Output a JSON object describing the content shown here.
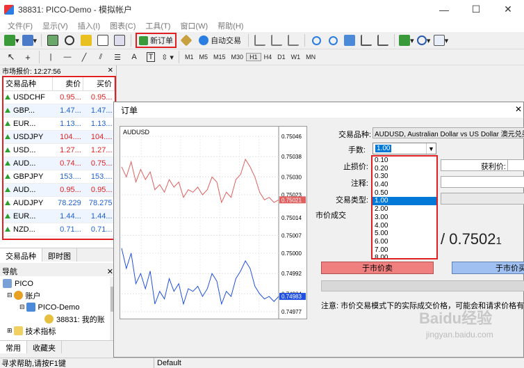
{
  "window": {
    "title": "38831: PICO-Demo - 模拟帐户",
    "controls": [
      "—",
      "☐",
      "✕"
    ]
  },
  "menu": [
    "文件(F)",
    "显示(V)",
    "插入(I)",
    "图表(C)",
    "工具(T)",
    "窗口(W)",
    "帮助(H)"
  ],
  "toolbar": {
    "new_order_label": "新订单",
    "auto_trade_label": "自动交易"
  },
  "timeframes": [
    "M1",
    "M5",
    "M15",
    "M30",
    "H1",
    "H4",
    "D1",
    "W1",
    "MN"
  ],
  "timeframe_active": "H1",
  "market_watch": {
    "header": "市场报价: 12:27:56",
    "col_symbol": "交易品种",
    "col_bid": "卖价",
    "col_ask": "买价",
    "rows": [
      {
        "symbol": "USDCHF",
        "bid": "0.95...",
        "ask": "0.95...",
        "dir": "up",
        "color": "red"
      },
      {
        "symbol": "GBP...",
        "bid": "1.47...",
        "ask": "1.47...",
        "dir": "up",
        "color": "blue"
      },
      {
        "symbol": "EUR...",
        "bid": "1.13...",
        "ask": "1.13...",
        "dir": "up",
        "color": "blue"
      },
      {
        "symbol": "USDJPY",
        "bid": "104....",
        "ask": "104....",
        "dir": "up",
        "color": "red"
      },
      {
        "symbol": "USD...",
        "bid": "1.27...",
        "ask": "1.27...",
        "dir": "up",
        "color": "red"
      },
      {
        "symbol": "AUD...",
        "bid": "0.74...",
        "ask": "0.75...",
        "dir": "up",
        "color": "red"
      },
      {
        "symbol": "GBPJPY",
        "bid": "153....",
        "ask": "153....",
        "dir": "up",
        "color": "blue"
      },
      {
        "symbol": "AUD...",
        "bid": "0.95...",
        "ask": "0.95...",
        "dir": "up",
        "color": "red"
      },
      {
        "symbol": "AUDJPY",
        "bid": "78.229",
        "ask": "78.275",
        "dir": "up",
        "color": "blue"
      },
      {
        "symbol": "EUR...",
        "bid": "1.44...",
        "ask": "1.44...",
        "dir": "up",
        "color": "blue"
      },
      {
        "symbol": "NZD...",
        "bid": "0.71...",
        "ask": "0.71...",
        "dir": "up",
        "color": "blue"
      }
    ],
    "tabs": [
      "交易品种",
      "即时图"
    ]
  },
  "navigator": {
    "header": "导航",
    "items": [
      "PICO",
      "账户",
      "PICO-Demo",
      "38831: 我的账",
      "技术指标"
    ],
    "tabs": [
      "常用",
      "收藏夹"
    ]
  },
  "status": {
    "help": "寻求帮助,请按F1键",
    "profile": "Default"
  },
  "order_dialog": {
    "title": "订单",
    "chart_symbol": "AUDUSD",
    "price_ticks": [
      "0.75046",
      "0.75038",
      "0.75030",
      "0.75023",
      "0.75014",
      "0.75007",
      "0.75000",
      "0.74992",
      "0.74984",
      "0.74983",
      "0.74977"
    ],
    "price_tag_ask": "0.75021",
    "price_tag_bid": "0.74983",
    "symbol_label": "交易品种:",
    "symbol_value": "AUDUSD, Australian Dollar vs US Dollar 澳元兑美元",
    "lots_label": "手数:",
    "lots_value": "1.00",
    "lots_options": [
      "0.10",
      "0.20",
      "0.30",
      "0.40",
      "0.50",
      "1.00",
      "2.00",
      "3.00",
      "4.00",
      "5.00",
      "6.00",
      "7.00",
      "8.00"
    ],
    "sl_label": "止损价:",
    "tp_label": "获利价:",
    "comment_label": "注释:",
    "type_label": "交易类型:",
    "market_exec": "市价成交",
    "price_display": "/ 0.7502",
    "price_small": "1",
    "sell_button": "于市价卖",
    "buy_button": "于市价买",
    "note": "注意: 市价交易模式下的实际成交价格，可能会和请求价格有"
  },
  "chart_data": {
    "type": "line",
    "title": "AUDUSD",
    "ylim": [
      0.74977,
      0.75046
    ],
    "series": [
      {
        "name": "Ask",
        "color": "#e06060",
        "values": [
          0.75034,
          0.7503,
          0.75036,
          0.75028,
          0.75033,
          0.75029,
          0.75032,
          0.75025,
          0.75027,
          0.75024,
          0.75029,
          0.75026,
          0.75028,
          0.75022,
          0.75025,
          0.75024,
          0.75026,
          0.75023,
          0.75025,
          0.7503,
          0.75028,
          0.7502,
          0.75024,
          0.75022,
          0.75029,
          0.75031,
          0.75037,
          0.75034,
          0.7503,
          0.75024,
          0.75021,
          0.75022,
          0.7502,
          0.75021
        ]
      },
      {
        "name": "Bid",
        "color": "#2050e0",
        "values": [
          0.75002,
          0.74994,
          0.75,
          0.74988,
          0.74992,
          0.74986,
          0.74993,
          0.7498,
          0.74985,
          0.74982,
          0.7499,
          0.74985,
          0.74988,
          0.7498,
          0.74986,
          0.74985,
          0.74987,
          0.74983,
          0.74986,
          0.74992,
          0.74989,
          0.7498,
          0.74985,
          0.74983,
          0.7499,
          0.74993,
          0.74997,
          0.74994,
          0.74987,
          0.74984,
          0.74982,
          0.74983,
          0.74981,
          0.74983
        ]
      }
    ]
  },
  "watermark": {
    "logo": "Baidu经验",
    "url": "jingyan.baidu.com"
  }
}
